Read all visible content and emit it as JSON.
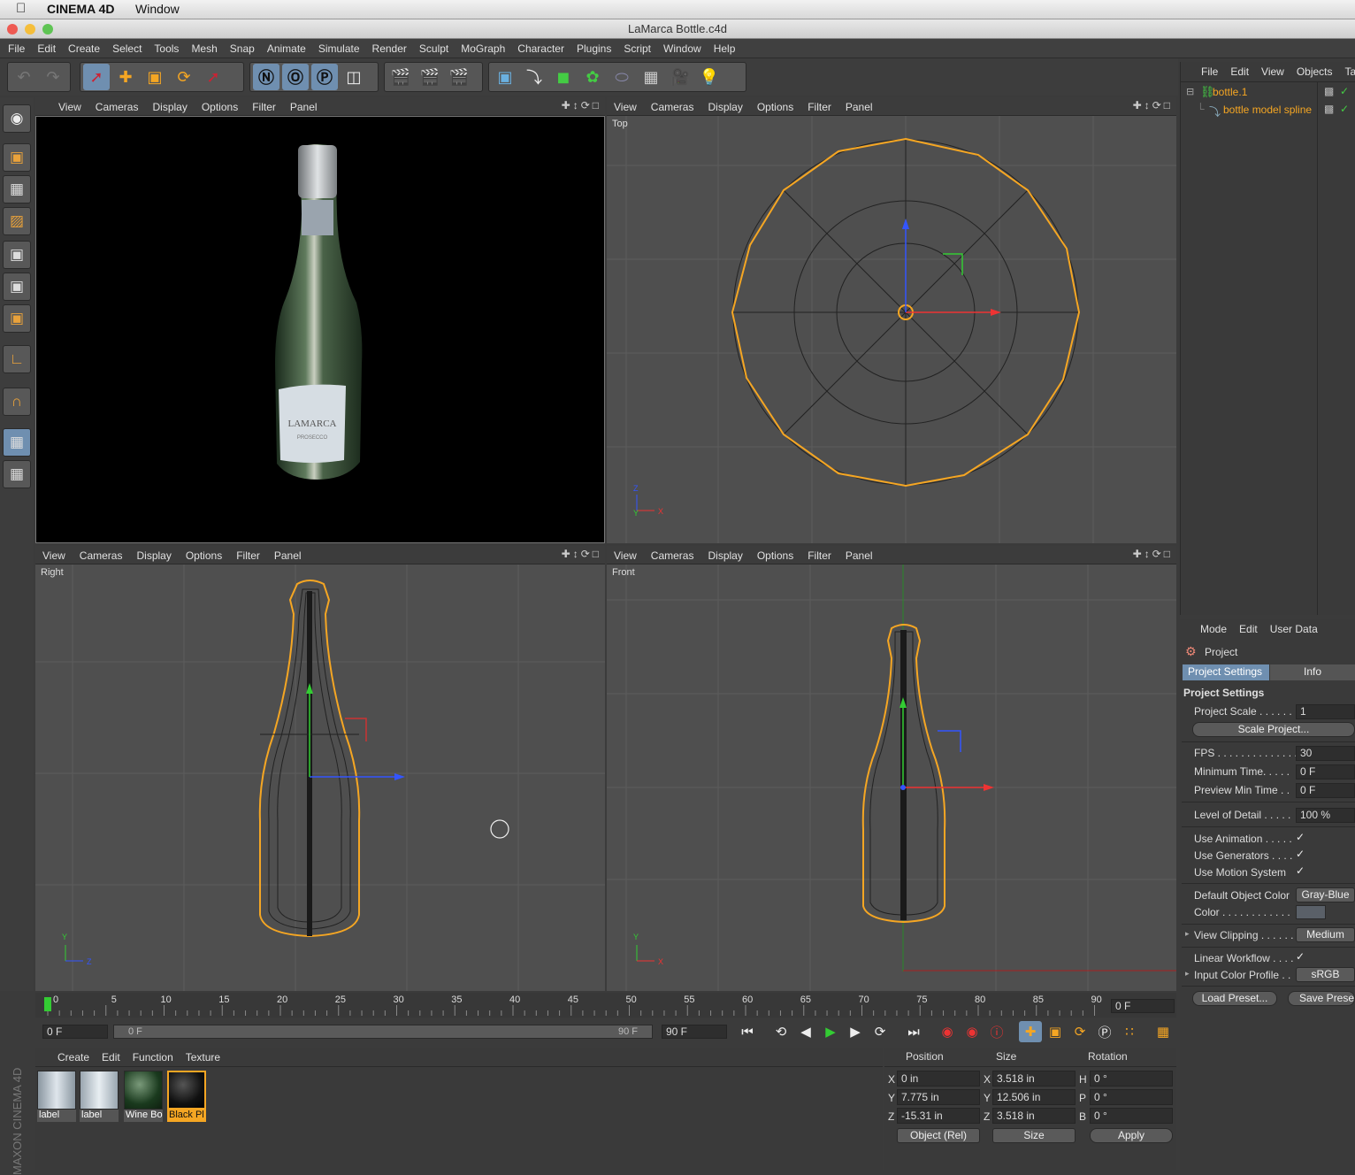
{
  "macbar": {
    "app": "CINEMA 4D",
    "window_menu": "Window"
  },
  "window": {
    "title": "LaMarca Bottle.c4d"
  },
  "menus": [
    "File",
    "Edit",
    "Create",
    "Select",
    "Tools",
    "Mesh",
    "Snap",
    "Animate",
    "Simulate",
    "Render",
    "Sculpt",
    "MoGraph",
    "Character",
    "Plugins",
    "Script",
    "Window",
    "Help"
  ],
  "viewport_menu": [
    "View",
    "Cameras",
    "Display",
    "Options",
    "Filter",
    "Panel"
  ],
  "viewports": {
    "top_label": "Top",
    "right_label": "Right",
    "front_label": "Front"
  },
  "bottle_label": {
    "brand": "LAMARCA",
    "sub": "PROSECCO"
  },
  "objects": {
    "menu": [
      "File",
      "Edit",
      "View",
      "Objects",
      "Ta"
    ],
    "items": [
      {
        "name": "bottle.1",
        "icon": "bottle-icon"
      },
      {
        "name": "bottle model spline",
        "icon": "spline-icon"
      }
    ]
  },
  "attributes": {
    "menu": [
      "Mode",
      "Edit",
      "User Data"
    ],
    "header": "Project",
    "tabs": [
      "Project Settings",
      "Info"
    ],
    "section": "Project Settings",
    "project_scale_label": "Project Scale . . . . . . .",
    "project_scale_value": "1",
    "scale_project_button": "Scale Project...",
    "fps_label": "FPS . . . . . . . . . . . . . . .",
    "fps_value": "30",
    "min_time_label": "Minimum Time. . . . .",
    "min_time_value": "0 F",
    "preview_min_label": "Preview Min Time . .",
    "preview_min_value": "0 F",
    "lod_label": "Level of Detail . . . . .",
    "lod_value": "100 %",
    "use_animation_label": "Use Animation . . . . .",
    "use_generators_label": "Use Generators . . . .",
    "use_motion_label": "Use Motion System",
    "default_color_label": "Default Object Color",
    "default_color_value": "Gray-Blue",
    "color_label": "Color . . . . . . . . . . . .",
    "view_clipping_label": "View Clipping . . . . . .",
    "view_clipping_value": "Medium",
    "linear_workflow_label": "Linear Workflow . . . .",
    "input_profile_label": "Input Color Profile . .",
    "input_profile_value": "sRGB",
    "load_preset": "Load Preset...",
    "save_preset": "Save Preset..."
  },
  "timeline": {
    "ticks": [
      "0",
      "5",
      "10",
      "15",
      "20",
      "25",
      "30",
      "35",
      "40",
      "45",
      "50",
      "55",
      "60",
      "65",
      "70",
      "75",
      "80",
      "85",
      "90"
    ],
    "current_frame": "0 F"
  },
  "transport": {
    "start_field": "0 F",
    "range_start": "0 F",
    "range_end": "90 F",
    "end_field": "90 F"
  },
  "materials": {
    "menu": [
      "Create",
      "Edit",
      "Function",
      "Texture"
    ],
    "items": [
      "label",
      "label",
      "Wine Bo",
      "Black Pl"
    ]
  },
  "coordinates": {
    "headers": [
      "Position",
      "Size",
      "Rotation"
    ],
    "pos": [
      {
        "axis": "X",
        "value": "0 in"
      },
      {
        "axis": "Y",
        "value": "7.775 in"
      },
      {
        "axis": "Z",
        "value": "-15.31 in"
      }
    ],
    "size": [
      {
        "axis": "X",
        "value": "3.518 in"
      },
      {
        "axis": "Y",
        "value": "12.506 in"
      },
      {
        "axis": "Z",
        "value": "3.518 in"
      }
    ],
    "rot": [
      {
        "axis": "H",
        "value": "0 °"
      },
      {
        "axis": "P",
        "value": "0 °"
      },
      {
        "axis": "B",
        "value": "0 °"
      }
    ],
    "mode_dropdown": "Object (Rel)",
    "size_dropdown": "Size",
    "apply": "Apply"
  },
  "brand_vertical": "MAXON CINEMA 4D",
  "colors": {
    "accent": "#f5a623",
    "selection": "#6f8fb0",
    "spline": "#f5a623"
  }
}
